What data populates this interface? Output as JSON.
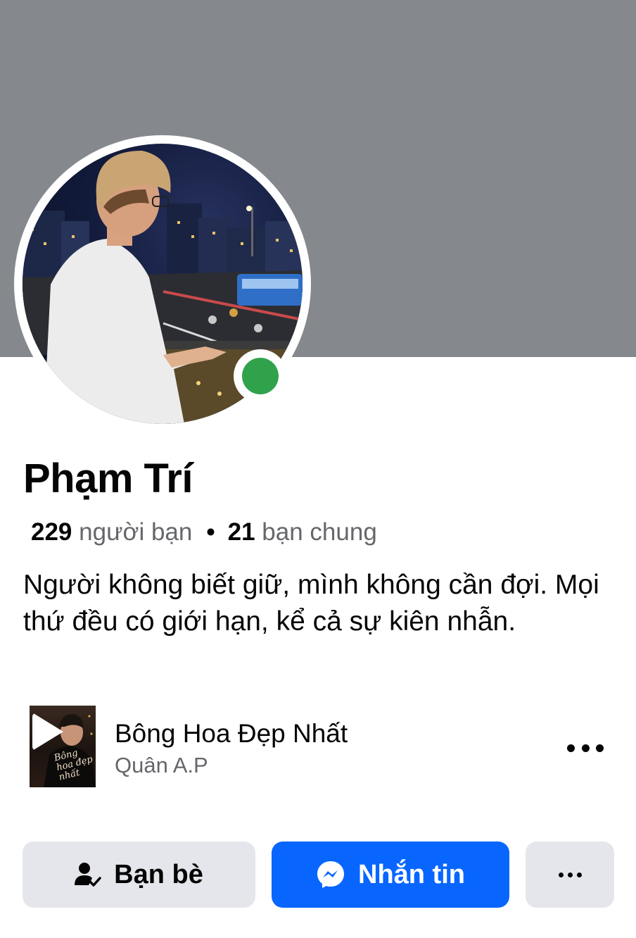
{
  "profile": {
    "name": "Phạm Trí",
    "friends_count": "229",
    "friends_label": "người bạn",
    "separator": "•",
    "mutual_count": "21",
    "mutual_label": "bạn chung",
    "bio": "Người không biết giữ, mình không cần đợi. Mọi thứ đều có giới hạn, kể cả sự kiên nhẫn.",
    "online": true
  },
  "music": {
    "title": "Bông Hoa Đẹp Nhất",
    "artist": "Quân A.P",
    "album_art_text": "Bông hoa đẹp nhất"
  },
  "actions": {
    "friends_label": "Bạn bè",
    "message_label": "Nhắn tin"
  },
  "icons": {
    "music_menu": "more-horizontal-icon",
    "friends": "person-check-icon",
    "message": "messenger-icon",
    "more": "more-horizontal-icon",
    "play": "play-icon"
  },
  "colors": {
    "cover": "#85888d",
    "online": "#31a24c",
    "primary": "#0866ff",
    "secondary_button": "#e4e6eb",
    "secondary_text": "#65676b"
  }
}
